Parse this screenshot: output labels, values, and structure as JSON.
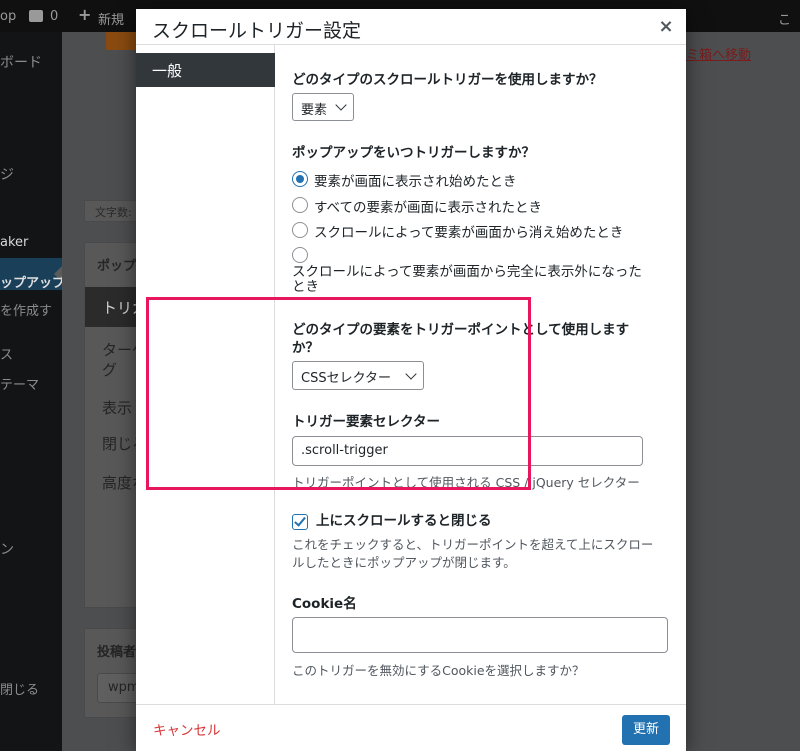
{
  "adminbar": {
    "site_label": "op",
    "comment_count": "0",
    "new_label": "新規",
    "right_fragment": "こ"
  },
  "sidebar": {
    "items": [
      {
        "label": "ボード"
      },
      {
        "label": "ジ"
      },
      {
        "label": "aker"
      },
      {
        "label": "ップアップ"
      },
      {
        "label": "を作成す"
      },
      {
        "label": "ス"
      },
      {
        "label": "テーマ"
      },
      {
        "label": "ン"
      },
      {
        "label": "閉じる"
      }
    ]
  },
  "background": {
    "trash_link": "ミ箱へ移動",
    "word_count": "文字数:",
    "popup_settings_title": "ポップ",
    "settings_tabs": [
      "トリガ",
      "ターゲ",
      "グ",
      "表示",
      "閉じる",
      "高度な"
    ],
    "author_title": "投稿者",
    "author_value": "wpm"
  },
  "modal": {
    "title": "スクロールトリガー設定",
    "close_symbol": "×",
    "nav": {
      "general_tab": "一般"
    },
    "trigger_type": {
      "question": "どのタイプのスクロールトリガーを使用しますか？",
      "selected": "要素"
    },
    "when_trigger": {
      "question": "ポップアップをいつトリガーしますか？",
      "options": [
        {
          "label": "要素が画面に表示され始めたとき",
          "checked": true
        },
        {
          "label": "すべての要素が画面に表示されたとき",
          "checked": false
        },
        {
          "label": "スクロールによって要素が画面から消え始めたとき",
          "checked": false
        },
        {
          "label": "スクロールによって要素が画面から完全に表示外になったとき",
          "checked": false
        }
      ],
      "option4_line1": "スクロールによって要素が画面から完全に表示外になった",
      "option4_line2": "とき"
    },
    "element_type": {
      "question_line1": "どのタイプの要素をトリガーポイントとして使用します",
      "question_line2": "か？",
      "selected": "CSSセレクター"
    },
    "selector": {
      "label": "トリガー要素セレクター",
      "value": ".scroll-trigger",
      "description": "トリガーポイントとして使用される CSS / jQuery セレクター"
    },
    "close_on_scroll_up": {
      "label": "上にスクロールすると閉じる",
      "checked": true,
      "description_line1": "これをチェックすると、トリガーポイントを超えて上にスクロー",
      "description_line2": "ルしたときにポップアップが閉じます。"
    },
    "cookie": {
      "label": "Cookie名",
      "value": "",
      "description": "このトリガーを無効にするCookieを選択しますか？"
    },
    "footer": {
      "cancel_label": "キャンセル",
      "update_label": "更新"
    }
  },
  "colors": {
    "accent": "#2271b1",
    "highlight_border": "#e8175d",
    "cancel": "#d63638"
  }
}
